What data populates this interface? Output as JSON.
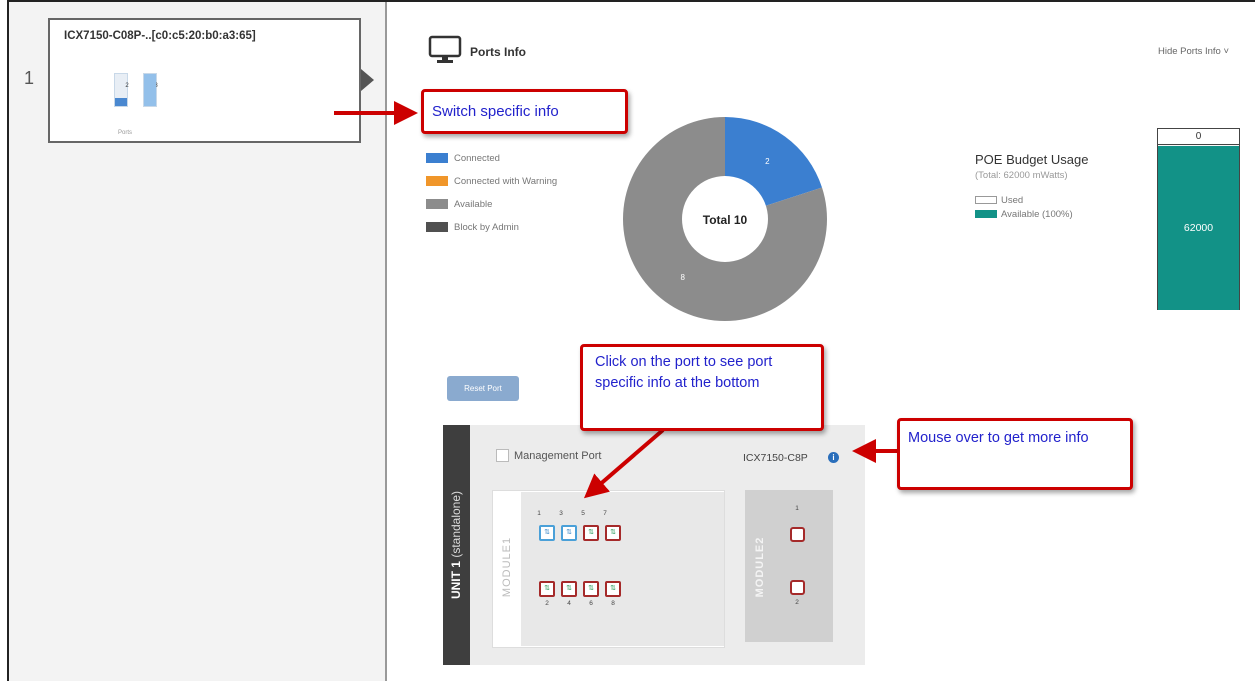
{
  "sidebar": {
    "row_number": "1",
    "switch_card": {
      "title": "ICX7150-C08P-..[c0:c5:20:b0:a3:65]",
      "bars": [
        {
          "label": "2",
          "fill_fraction": 0.25
        },
        {
          "label": "8",
          "fill_fraction": 1.0
        }
      ],
      "ports_label": "Ports"
    }
  },
  "ports_info": {
    "title": "Ports Info",
    "hide_link": "Hide Ports Info ˅",
    "legend": [
      {
        "label": "Connected",
        "color": "#3b7fd0"
      },
      {
        "label": "Connected with Warning",
        "color": "#f0962a"
      },
      {
        "label": "Available",
        "color": "#8c8c8c"
      },
      {
        "label": "Block by Admin",
        "color": "#505050"
      }
    ],
    "donut": {
      "center_label": "Total 10",
      "segments": [
        {
          "name": "Connected",
          "value": 2,
          "color": "#3b7fd0"
        },
        {
          "name": "Available",
          "value": 8,
          "color": "#8c8c8c"
        }
      ]
    }
  },
  "poe": {
    "title": "POE Budget Usage",
    "total": "(Total: 62000 mWatts)",
    "legend": [
      {
        "label": "Used",
        "color": "#ffffff"
      },
      {
        "label": "Available (100%)",
        "color": "#129287"
      }
    ],
    "used_value": "0",
    "available_value": "62000"
  },
  "callouts": {
    "switch_specific": "Switch specific info",
    "click_port": "Click on the port to see port specific info at the bottom",
    "mouse_over": "Mouse over to get more info"
  },
  "toolbar": {
    "reset_label": "Reset Port"
  },
  "unit": {
    "label": "UNIT 1",
    "sublabel": "(standalone)",
    "management_port_label": "Management Port",
    "model": "ICX7150-C8P",
    "info_glyph": "i",
    "module1": {
      "label": "MODULE1",
      "top_numbers": [
        "1",
        "3",
        "5",
        "7"
      ],
      "bottom_numbers": [
        "2",
        "4",
        "6",
        "8"
      ],
      "top_ports": [
        {
          "state": "connected",
          "glyph": "⇅"
        },
        {
          "state": "connected",
          "glyph": "⇅"
        },
        {
          "state": "available",
          "glyph": "⇅"
        },
        {
          "state": "available",
          "glyph": "⇅"
        }
      ],
      "bottom_ports": [
        {
          "state": "available",
          "glyph": "⇅"
        },
        {
          "state": "available",
          "glyph": "⇅"
        },
        {
          "state": "available",
          "glyph": "⇅"
        },
        {
          "state": "available",
          "glyph": "⇅"
        }
      ]
    },
    "module2": {
      "label": "MODULE2",
      "port_numbers": [
        "1",
        "2"
      ]
    }
  }
}
